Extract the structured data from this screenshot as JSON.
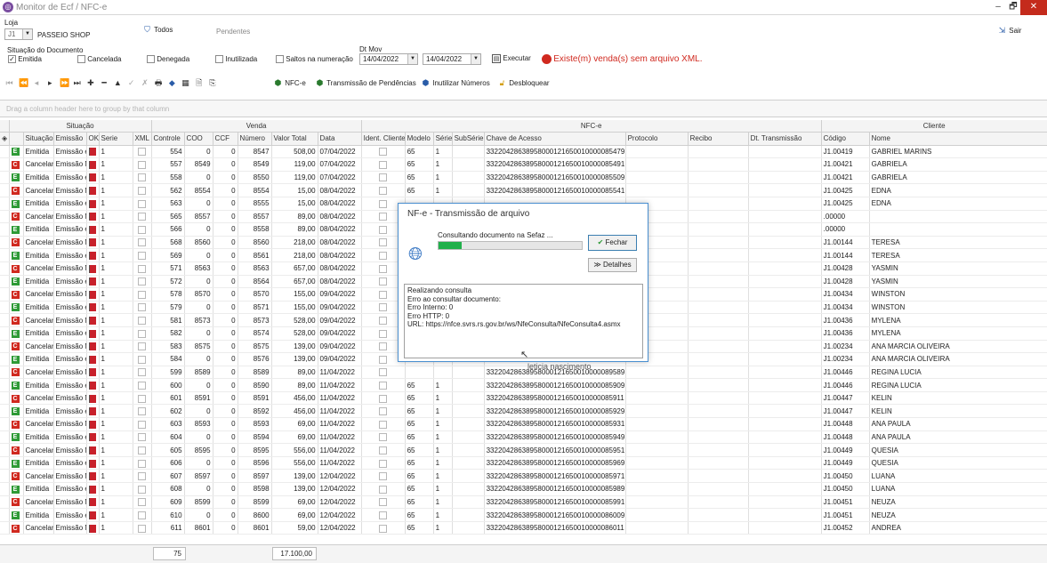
{
  "window": {
    "title": "Monitor de Ecf / NFC-e",
    "btn_min": "–",
    "btn_max": "🗗",
    "btn_close": "✕"
  },
  "filters": {
    "loja_label": "Loja",
    "loja_code": "J1",
    "loja_name": "PASSEIO SHOP",
    "todos_label": "Todos",
    "pendentes_label": "Pendentes",
    "sair_label": "Sair",
    "situacao_label": "Situação do Documento",
    "emitida": "Emitida",
    "cancelada": "Cancelada",
    "denegada": "Denegada",
    "inutilizada": "Inutilizada",
    "saltos": "Saltos na numeração",
    "dtmov_label": "Dt Mov",
    "date_from": "14/04/2022",
    "date_to": "14/04/2022",
    "executar_label": "Executar",
    "warning": "Existe(m) venda(s) sem arquivo XML."
  },
  "toolbar": {
    "nfce_label": "NFC-e",
    "transmissao_label": "Transmissão de Pendências",
    "inutilizar_label": "Inutilizar Números",
    "desbloquear_label": "Desbloquear"
  },
  "grid": {
    "group_hint": "Drag a column header here to group by that column",
    "bands": {
      "situacao": "Situação",
      "venda": "Venda",
      "nfce": "NFC-e",
      "cliente": "Cliente"
    },
    "headers": {
      "situacao": "Situação",
      "emissao": "Emissão",
      "ok": "OK",
      "serie": "Serie",
      "xml": "XML",
      "controle": "Controle",
      "coo": "COO",
      "ccf": "CCF",
      "numero": "Número",
      "valor_total": "Valor Total",
      "data": "Data",
      "ident_cliente": "Ident. Cliente",
      "modelo": "Modelo",
      "serie_nfce": "Série",
      "subserie": "SubSérie",
      "chave": "Chave de Acesso",
      "protocolo": "Protocolo",
      "recibo": "Recibo",
      "dt_transmissao": "Dt. Transmissão",
      "codigo": "Código",
      "nome": "Nome"
    },
    "rows": [
      {
        "status": "E",
        "situacao": "Emitida",
        "emissao": "Emissão e",
        "serie": "1",
        "controle": "554",
        "coo": "0",
        "ccf": "0",
        "numero": "8547",
        "valor": "508,00",
        "data": "07/04/2022",
        "modelo": "65",
        "serie_nfce": "1",
        "chave": "33220428638958000121650010000085479",
        "codigo": "J1.00419",
        "nome": "GABRIEL MARINS"
      },
      {
        "status": "C",
        "situacao": "Cancelar",
        "emissao": "Emissão N",
        "serie": "1",
        "controle": "557",
        "coo": "8549",
        "ccf": "0",
        "numero": "8549",
        "valor": "119,00",
        "data": "07/04/2022",
        "modelo": "65",
        "serie_nfce": "1",
        "chave": "33220428638958000121650010000085491",
        "codigo": "J1.00421",
        "nome": "GABRIELA"
      },
      {
        "status": "E",
        "situacao": "Emitida",
        "emissao": "Emissão e",
        "serie": "1",
        "controle": "558",
        "coo": "0",
        "ccf": "0",
        "numero": "8550",
        "valor": "119,00",
        "data": "07/04/2022",
        "modelo": "65",
        "serie_nfce": "1",
        "chave": "33220428638958000121650010000085509",
        "codigo": "J1.00421",
        "nome": "GABRIELA"
      },
      {
        "status": "C",
        "situacao": "Cancelar",
        "emissao": "Emissão N",
        "serie": "1",
        "controle": "562",
        "coo": "8554",
        "ccf": "0",
        "numero": "8554",
        "valor": "15,00",
        "data": "08/04/2022",
        "modelo": "65",
        "serie_nfce": "1",
        "chave": "33220428638958000121650010000085541",
        "codigo": "J1.00425",
        "nome": "EDNA"
      },
      {
        "status": "E",
        "situacao": "Emitida",
        "emissao": "Emissão e",
        "serie": "1",
        "controle": "563",
        "coo": "0",
        "ccf": "0",
        "numero": "8555",
        "valor": "15,00",
        "data": "08/04/2022",
        "modelo": "",
        "serie_nfce": "",
        "chave": "",
        "codigo": "J1.00425",
        "nome": "EDNA"
      },
      {
        "status": "C",
        "situacao": "Cancelar",
        "emissao": "Emissão N",
        "serie": "1",
        "controle": "565",
        "coo": "8557",
        "ccf": "0",
        "numero": "8557",
        "valor": "89,00",
        "data": "08/04/2022",
        "modelo": "",
        "serie_nfce": "",
        "chave": "",
        "codigo": ".00000",
        "nome": ""
      },
      {
        "status": "E",
        "situacao": "Emitida",
        "emissao": "Emissão e",
        "serie": "1",
        "controle": "566",
        "coo": "0",
        "ccf": "0",
        "numero": "8558",
        "valor": "89,00",
        "data": "08/04/2022",
        "modelo": "",
        "serie_nfce": "",
        "chave": "",
        "codigo": ".00000",
        "nome": ""
      },
      {
        "status": "C",
        "situacao": "Cancelar",
        "emissao": "Emissão N",
        "serie": "1",
        "controle": "568",
        "coo": "8560",
        "ccf": "0",
        "numero": "8560",
        "valor": "218,00",
        "data": "08/04/2022",
        "modelo": "",
        "serie_nfce": "",
        "chave": "",
        "codigo": "J1.00144",
        "nome": "TERESA"
      },
      {
        "status": "E",
        "situacao": "Emitida",
        "emissao": "Emissão e",
        "serie": "1",
        "controle": "569",
        "coo": "0",
        "ccf": "0",
        "numero": "8561",
        "valor": "218,00",
        "data": "08/04/2022",
        "modelo": "",
        "serie_nfce": "",
        "chave": "",
        "codigo": "J1.00144",
        "nome": "TERESA"
      },
      {
        "status": "C",
        "situacao": "Cancelar",
        "emissao": "Emissão N",
        "serie": "1",
        "controle": "571",
        "coo": "8563",
        "ccf": "0",
        "numero": "8563",
        "valor": "657,00",
        "data": "08/04/2022",
        "modelo": "",
        "serie_nfce": "",
        "chave": "",
        "codigo": "J1.00428",
        "nome": "YASMIN"
      },
      {
        "status": "E",
        "situacao": "Emitida",
        "emissao": "Emissão e",
        "serie": "1",
        "controle": "572",
        "coo": "0",
        "ccf": "0",
        "numero": "8564",
        "valor": "657,00",
        "data": "08/04/2022",
        "modelo": "",
        "serie_nfce": "",
        "chave": "",
        "codigo": "J1.00428",
        "nome": "YASMIN"
      },
      {
        "status": "C",
        "situacao": "Cancelar",
        "emissao": "Emissão N",
        "serie": "1",
        "controle": "578",
        "coo": "8570",
        "ccf": "0",
        "numero": "8570",
        "valor": "155,00",
        "data": "09/04/2022",
        "modelo": "",
        "serie_nfce": "",
        "chave": "",
        "codigo": "J1.00434",
        "nome": "WINSTON"
      },
      {
        "status": "E",
        "situacao": "Emitida",
        "emissao": "Emissão e",
        "serie": "1",
        "controle": "579",
        "coo": "0",
        "ccf": "0",
        "numero": "8571",
        "valor": "155,00",
        "data": "09/04/2022",
        "modelo": "",
        "serie_nfce": "",
        "chave": "",
        "codigo": "J1.00434",
        "nome": "WINSTON"
      },
      {
        "status": "C",
        "situacao": "Cancelar",
        "emissao": "Emissão N",
        "serie": "1",
        "controle": "581",
        "coo": "8573",
        "ccf": "0",
        "numero": "8573",
        "valor": "528,00",
        "data": "09/04/2022",
        "modelo": "",
        "serie_nfce": "",
        "chave": "",
        "codigo": "J1.00436",
        "nome": "MYLENA"
      },
      {
        "status": "E",
        "situacao": "Emitida",
        "emissao": "Emissão e",
        "serie": "1",
        "controle": "582",
        "coo": "0",
        "ccf": "0",
        "numero": "8574",
        "valor": "528,00",
        "data": "09/04/2022",
        "modelo": "",
        "serie_nfce": "",
        "chave": "",
        "codigo": "J1.00436",
        "nome": "MYLENA"
      },
      {
        "status": "C",
        "situacao": "Cancelar",
        "emissao": "Emissão N",
        "serie": "1",
        "controle": "583",
        "coo": "8575",
        "ccf": "0",
        "numero": "8575",
        "valor": "139,00",
        "data": "09/04/2022",
        "modelo": "",
        "serie_nfce": "",
        "chave": "",
        "codigo": "J1.00234",
        "nome": "ANA  MARCIA OLIVEIRA"
      },
      {
        "status": "E",
        "situacao": "Emitida",
        "emissao": "Emissão e",
        "serie": "1",
        "controle": "584",
        "coo": "0",
        "ccf": "0",
        "numero": "8576",
        "valor": "139,00",
        "data": "09/04/2022",
        "modelo": "",
        "serie_nfce": "",
        "chave": "",
        "codigo": "J1.00234",
        "nome": "ANA  MARCIA OLIVEIRA"
      },
      {
        "status": "C",
        "situacao": "Cancelar",
        "emissao": "Emissão N",
        "serie": "1",
        "controle": "599",
        "coo": "8589",
        "ccf": "0",
        "numero": "8589",
        "valor": "89,00",
        "data": "11/04/2022",
        "modelo": "",
        "serie_nfce": "",
        "chave": "3322042863895800012165001000008958910",
        "codigo": "J1.00446",
        "nome": "REGINA LUCIA"
      },
      {
        "status": "E",
        "situacao": "Emitida",
        "emissao": "Emissão e",
        "serie": "1",
        "controle": "600",
        "coo": "0",
        "ccf": "0",
        "numero": "8590",
        "valor": "89,00",
        "data": "11/04/2022",
        "modelo": "65",
        "serie_nfce": "1",
        "chave": "33220428638958000121650010000085909",
        "codigo": "J1.00446",
        "nome": "REGINA LUCIA"
      },
      {
        "status": "C",
        "situacao": "Cancelar",
        "emissao": "Emissão N",
        "serie": "1",
        "controle": "601",
        "coo": "8591",
        "ccf": "0",
        "numero": "8591",
        "valor": "456,00",
        "data": "11/04/2022",
        "modelo": "65",
        "serie_nfce": "1",
        "chave": "33220428638958000121650010000085911",
        "codigo": "J1.00447",
        "nome": "KELIN"
      },
      {
        "status": "E",
        "situacao": "Emitida",
        "emissao": "Emissão e",
        "serie": "1",
        "controle": "602",
        "coo": "0",
        "ccf": "0",
        "numero": "8592",
        "valor": "456,00",
        "data": "11/04/2022",
        "modelo": "65",
        "serie_nfce": "1",
        "chave": "33220428638958000121650010000085929",
        "codigo": "J1.00447",
        "nome": "KELIN"
      },
      {
        "status": "C",
        "situacao": "Cancelar",
        "emissao": "Emissão N",
        "serie": "1",
        "controle": "603",
        "coo": "8593",
        "ccf": "0",
        "numero": "8593",
        "valor": "69,00",
        "data": "11/04/2022",
        "modelo": "65",
        "serie_nfce": "1",
        "chave": "33220428638958000121650010000085931",
        "codigo": "J1.00448",
        "nome": "ANA PAULA"
      },
      {
        "status": "E",
        "situacao": "Emitida",
        "emissao": "Emissão e",
        "serie": "1",
        "controle": "604",
        "coo": "0",
        "ccf": "0",
        "numero": "8594",
        "valor": "69,00",
        "data": "11/04/2022",
        "modelo": "65",
        "serie_nfce": "1",
        "chave": "33220428638958000121650010000085949",
        "codigo": "J1.00448",
        "nome": "ANA PAULA"
      },
      {
        "status": "C",
        "situacao": "Cancelar",
        "emissao": "Emissão N",
        "serie": "1",
        "controle": "605",
        "coo": "8595",
        "ccf": "0",
        "numero": "8595",
        "valor": "556,00",
        "data": "11/04/2022",
        "modelo": "65",
        "serie_nfce": "1",
        "chave": "33220428638958000121650010000085951",
        "codigo": "J1.00449",
        "nome": "QUESIA"
      },
      {
        "status": "E",
        "situacao": "Emitida",
        "emissao": "Emissão e",
        "serie": "1",
        "controle": "606",
        "coo": "0",
        "ccf": "0",
        "numero": "8596",
        "valor": "556,00",
        "data": "11/04/2022",
        "modelo": "65",
        "serie_nfce": "1",
        "chave": "33220428638958000121650010000085969",
        "codigo": "J1.00449",
        "nome": "QUESIA"
      },
      {
        "status": "C",
        "situacao": "Cancelar",
        "emissao": "Emissão N",
        "serie": "1",
        "controle": "607",
        "coo": "8597",
        "ccf": "0",
        "numero": "8597",
        "valor": "139,00",
        "data": "12/04/2022",
        "modelo": "65",
        "serie_nfce": "1",
        "chave": "33220428638958000121650010000085971",
        "codigo": "J1.00450",
        "nome": "LUANA"
      },
      {
        "status": "E",
        "situacao": "Emitida",
        "emissao": "Emissão e",
        "serie": "1",
        "controle": "608",
        "coo": "0",
        "ccf": "0",
        "numero": "8598",
        "valor": "139,00",
        "data": "12/04/2022",
        "modelo": "65",
        "serie_nfce": "1",
        "chave": "33220428638958000121650010000085989",
        "codigo": "J1.00450",
        "nome": "LUANA"
      },
      {
        "status": "C",
        "situacao": "Cancelar",
        "emissao": "Emissão N",
        "serie": "1",
        "controle": "609",
        "coo": "8599",
        "ccf": "0",
        "numero": "8599",
        "valor": "69,00",
        "data": "12/04/2022",
        "modelo": "65",
        "serie_nfce": "1",
        "chave": "33220428638958000121650010000085991",
        "codigo": "J1.00451",
        "nome": "NEUZA"
      },
      {
        "status": "E",
        "situacao": "Emitida",
        "emissao": "Emissão e",
        "serie": "1",
        "controle": "610",
        "coo": "0",
        "ccf": "0",
        "numero": "8600",
        "valor": "69,00",
        "data": "12/04/2022",
        "modelo": "65",
        "serie_nfce": "1",
        "chave": "33220428638958000121650010000086009",
        "codigo": "J1.00451",
        "nome": "NEUZA"
      },
      {
        "status": "C",
        "situacao": "Cancelar",
        "emissao": "Emissão N",
        "serie": "1",
        "controle": "611",
        "coo": "8601",
        "ccf": "0",
        "numero": "8601",
        "valor": "59,00",
        "data": "12/04/2022",
        "modelo": "65",
        "serie_nfce": "1",
        "chave": "33220428638958000121650010000086011",
        "codigo": "J1.00452",
        "nome": "ANDREA"
      }
    ],
    "footer": {
      "count": "75",
      "total": "17.100,00"
    }
  },
  "dialog": {
    "title": "NF-e - Transmissão de arquivo",
    "status_text": "Consultando documento na Sefaz ...",
    "progress": 0.16,
    "fechar_label": "Fechar",
    "detalhes_label": "Detalhes",
    "log_lines": [
      "Realizando consulta",
      "Erro ao consultar documento:",
      "Erro Interno: 0",
      "Erro HTTP: 0",
      "URL: https://nfce.svrs.rs.gov.br/ws/NfeConsulta/NfeConsulta4.asmx"
    ],
    "overlay_text": "leticia nascimento"
  },
  "colors": {
    "emitida": "#2e9a36",
    "cancelada": "#d0291f",
    "warning": "#d0291f",
    "accent": "#4a8fd0"
  }
}
